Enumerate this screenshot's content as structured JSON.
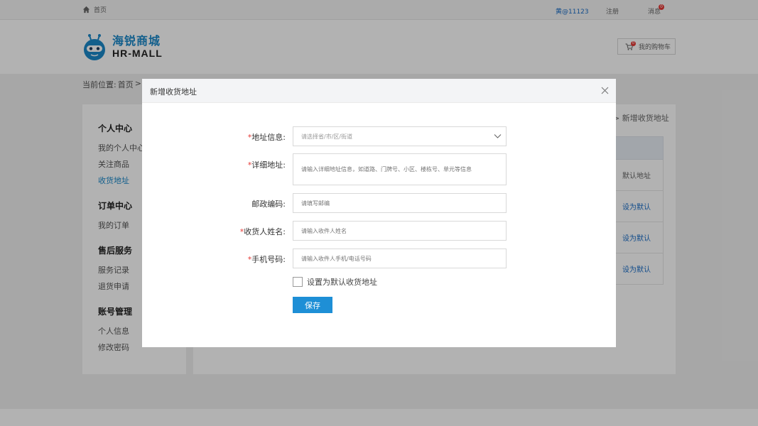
{
  "topbar": {
    "home_label": "首页",
    "user_label": "黄@11123",
    "register_label": "注册",
    "message_label": "消息",
    "message_badge": "0"
  },
  "header": {
    "brand_cn": "海锐商城",
    "brand_en": "HR-MALL",
    "cart_label": "我的购物车",
    "cart_badge": "0"
  },
  "breadcrumb": {
    "prefix": "当前位置:",
    "home": "首页",
    "separator": ">"
  },
  "sidebar": {
    "groups": [
      {
        "title": "个人中心",
        "items": [
          "我的个人中心",
          "关注商品",
          "收货地址"
        ]
      },
      {
        "title": "订单中心",
        "items": [
          "我的订单"
        ]
      },
      {
        "title": "售后服务",
        "items": [
          "服务记录",
          "退货申请"
        ]
      },
      {
        "title": "账号管理",
        "items": [
          "个人信息",
          "修改密码"
        ]
      }
    ],
    "active_item": "收货地址"
  },
  "main": {
    "crumb_right": "> 新增收货地址",
    "rows": [
      {
        "action": "默认地址",
        "type": "default"
      },
      {
        "action": "设为默认",
        "type": "link"
      },
      {
        "action": "设为默认",
        "type": "link"
      },
      {
        "action": "设为默认",
        "type": "link"
      }
    ]
  },
  "dialog": {
    "title": "新增收货地址",
    "fields": {
      "region": {
        "label": "地址信息:",
        "required": true,
        "placeholder": "请选择省/市/区/街道"
      },
      "detail": {
        "label": "详细地址:",
        "required": true,
        "placeholder": "请输入详细地址信息，如道路、门牌号、小区、楼栋号、单元等信息"
      },
      "postcode": {
        "label": "邮政编码:",
        "required": false,
        "placeholder": "请填写邮编"
      },
      "receiver": {
        "label": "收货人姓名:",
        "required": true,
        "placeholder": "请输入收件人姓名"
      },
      "phone": {
        "label": "手机号码:",
        "required": true,
        "placeholder": "请输入收件人手机/电话号码"
      }
    },
    "required_mark": "*",
    "default_checkbox_label": "设置为默认收货地址",
    "save_label": "保存"
  },
  "colors": {
    "accent": "#1e8fd6",
    "link": "#1a6ec8",
    "required": "#e53935"
  }
}
